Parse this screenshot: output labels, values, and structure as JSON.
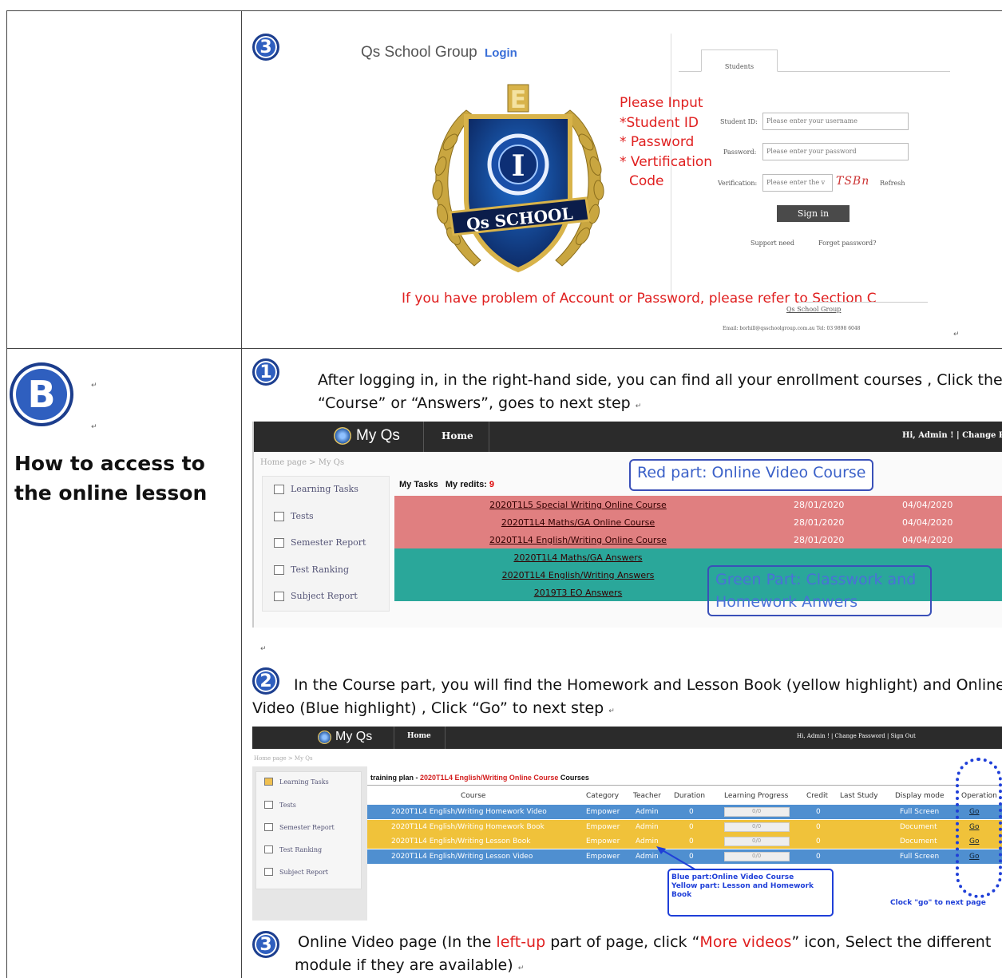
{
  "section_b": {
    "letter": "B",
    "title": "How to access to the online lesson",
    "return_mark": "↵"
  },
  "login": {
    "step_number": "3",
    "brand": "Qs School Group",
    "login_link": "Login",
    "logo_letter": "E",
    "logo_inner": "I",
    "logo_banner": "Qs SCHOOL",
    "instructions": [
      "Please Input",
      "*Student ID",
      "* Password",
      "* Vertification",
      "Code"
    ],
    "tab_label": "Students",
    "id_label": "Student ID:",
    "id_placeholder": "Please enter your username",
    "pw_label": "Password:",
    "pw_placeholder": "Please enter your password",
    "ver_label": "Verification:",
    "ver_placeholder": "Please enter the v",
    "captcha": "TSBn",
    "refresh": "Refresh",
    "signin": "Sign in",
    "support": "Support need",
    "forget": "Forget password?",
    "problem_note": "If you have problem of Account or Password, please refer to Section C",
    "footer_brand": "Qs School Group",
    "footer_contact": "Email: borhill@qsschoolgroup.com.au Tel: 03 9898 6048"
  },
  "step1": {
    "number": "1",
    "text_line1": "After logging in, in the right-hand side, you can find all your enrollment courses , Click the",
    "text_line2": "“Course” or “Answers”, goes to next step"
  },
  "myqs1": {
    "logo": "My Qs",
    "home": "Home",
    "user": "Hi, Admin ! | Change P",
    "breadcrumb": "Home page > My Qs",
    "sidebar": [
      "Learning Tasks",
      "Tests",
      "Semester Report",
      "Test Ranking",
      "Subject Report"
    ],
    "tasks_label": "My Tasks",
    "credits_label": "My redits:",
    "credits_value": "9",
    "red_note": "Red part: Online Video Course",
    "green_note_line1": "Green Part: Classwork and",
    "green_note_line2": "Homework Anwers",
    "rows": [
      {
        "name": "2020T1L5 Special Writing Online Course",
        "d1": "28/01/2020",
        "d2": "04/04/2020",
        "color": "#e07f80"
      },
      {
        "name": "2020T1L4 Maths/GA Online Course",
        "d1": "28/01/2020",
        "d2": "04/04/2020",
        "color": "#e07f80"
      },
      {
        "name": "2020T1L4 English/Writing Online Course",
        "d1": "28/01/2020",
        "d2": "04/04/2020",
        "color": "#e07f80"
      },
      {
        "name": "2020T1L4 Maths/GA Answers",
        "d1": "",
        "d2": "",
        "color": "#2aa79a"
      },
      {
        "name": "2020T1L4 English/Writing Answers",
        "d1": "",
        "d2": "",
        "color": "#2aa79a"
      },
      {
        "name": "2019T3 EO Answers",
        "d1": "",
        "d2": "",
        "color": "#2aa79a"
      }
    ]
  },
  "step2": {
    "number": "2",
    "text_line1": "In the Course part, you will find the Homework and Lesson Book (yellow highlight) and Online",
    "text_line2": "Video (Blue highlight) , Click “Go” to next step"
  },
  "myqs2": {
    "logo": "My Qs",
    "home": "Home",
    "user": "Hi, Admin ! | Change Password | Sign Out",
    "breadcrumb": "Home page > My Qs",
    "sidebar": [
      "Learning Tasks",
      "Tests",
      "Semester Report",
      "Test Ranking",
      "Subject Report"
    ],
    "plan_prefix": "training plan - ",
    "plan_course": "2020T1L4 English/Writing Online Course",
    "plan_suffix": " Courses",
    "headers": [
      "Course",
      "Category",
      "Teacher",
      "Duration",
      "Learning Progress",
      "Credit",
      "Last Study",
      "Display mode",
      "Operation"
    ],
    "rows": [
      {
        "course": "2020T1L4 English/Writing Homework Video",
        "category": "Empower",
        "teacher": "Admin",
        "duration": "0",
        "progress": "0/0",
        "credit": "0",
        "mode": "Full Screen",
        "op": "Go",
        "color": "#4f8fd0"
      },
      {
        "course": "2020T1L4 English/Writing Homework Book",
        "category": "Empower",
        "teacher": "Admin",
        "duration": "0",
        "progress": "0/0",
        "credit": "0",
        "mode": "Document",
        "op": "Go",
        "color": "#f0c23a"
      },
      {
        "course": "2020T1L4 English/Writing Lesson Book",
        "category": "Empower",
        "teacher": "Admin",
        "duration": "0",
        "progress": "0/0",
        "credit": "0",
        "mode": "Document",
        "op": "Go",
        "color": "#f0c23a"
      },
      {
        "course": "2020T1L4 English/Writing Lesson Video",
        "category": "Empower",
        "teacher": "Admin",
        "duration": "0",
        "progress": "0/0",
        "credit": "0",
        "mode": "Full Screen",
        "op": "Go",
        "color": "#4f8fd0"
      }
    ],
    "note_line1": "Blue part:Online Video Course",
    "note_line2": "Yellow part: Lesson and Homework",
    "note_line3": "Book",
    "go_note": "Clock \"go\" to next page"
  },
  "step3": {
    "number": "3",
    "text_a": "Online Video page (In the ",
    "text_red1": "left-up",
    "text_b": " part of page, click “",
    "text_red2": "More videos",
    "text_c": "” icon, Select the different",
    "text_line2": "module if they are available)"
  }
}
